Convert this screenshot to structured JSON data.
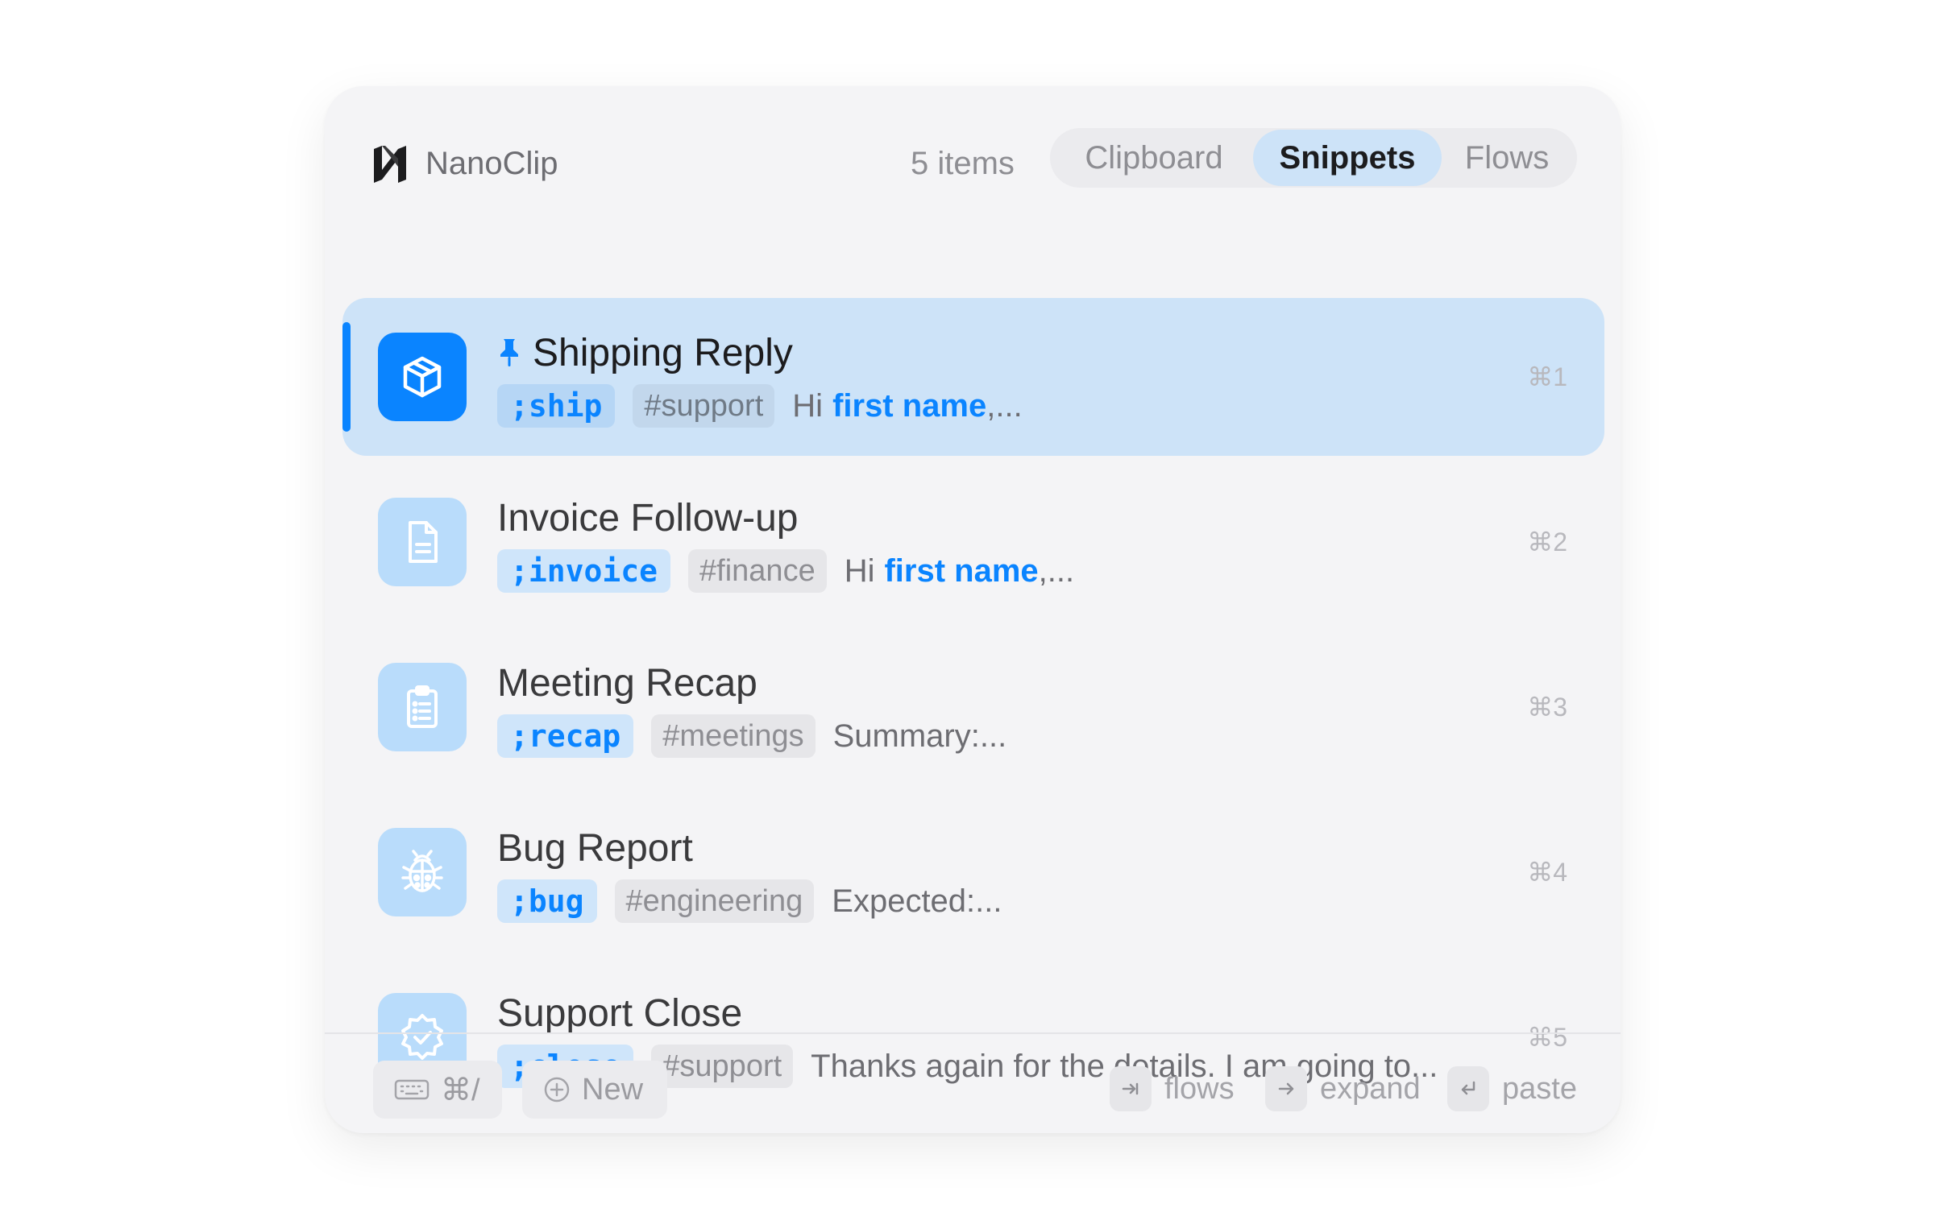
{
  "app": {
    "name": "NanoClip",
    "logo_icon": "nanoclip-logo-icon"
  },
  "header": {
    "item_count": "5 items",
    "tabs": [
      {
        "label": "Clipboard",
        "active": false
      },
      {
        "label": "Snippets",
        "active": true
      },
      {
        "label": "Flows",
        "active": false
      }
    ]
  },
  "snippets": [
    {
      "title": "Shipping Reply",
      "icon": "package-icon",
      "pinned": true,
      "selected": true,
      "keyword": ";ship",
      "tag": "#support",
      "preview_prefix": "Hi",
      "preview_var": "first name",
      "preview_suffix": ",...",
      "shortcut": "⌘1"
    },
    {
      "title": "Invoice Follow-up",
      "icon": "document-icon",
      "keyword": ";invoice",
      "tag": "#finance",
      "preview_prefix": "Hi",
      "preview_var": "first name",
      "preview_suffix": ",...",
      "shortcut": "⌘2"
    },
    {
      "title": "Meeting Recap",
      "icon": "clipboard-list-icon",
      "keyword": ";recap",
      "tag": "#meetings",
      "preview_prefix": "Summary:...",
      "shortcut": "⌘3"
    },
    {
      "title": "Bug Report",
      "icon": "ladybug-icon",
      "keyword": ";bug",
      "tag": "#engineering",
      "preview_prefix": "Expected:...",
      "shortcut": "⌘4"
    },
    {
      "title": "Support Close",
      "icon": "verified-badge-icon",
      "keyword": ";close",
      "tag": "#support",
      "preview_prefix": "Thanks again for the details. I am going to...",
      "shortcut": "⌘5"
    }
  ],
  "footer": {
    "keyboard_shortcut": "⌘/",
    "new_label": "New",
    "hints": [
      {
        "key_icon": "tab-key-icon",
        "label": "flows"
      },
      {
        "key_icon": "arrow-right-icon",
        "label": "expand"
      },
      {
        "key_icon": "return-key-icon",
        "label": "paste"
      }
    ]
  },
  "colors": {
    "accent": "#0a84ff",
    "selected_row": "#cde3f8",
    "panel_bg": "#f4f4f6"
  }
}
